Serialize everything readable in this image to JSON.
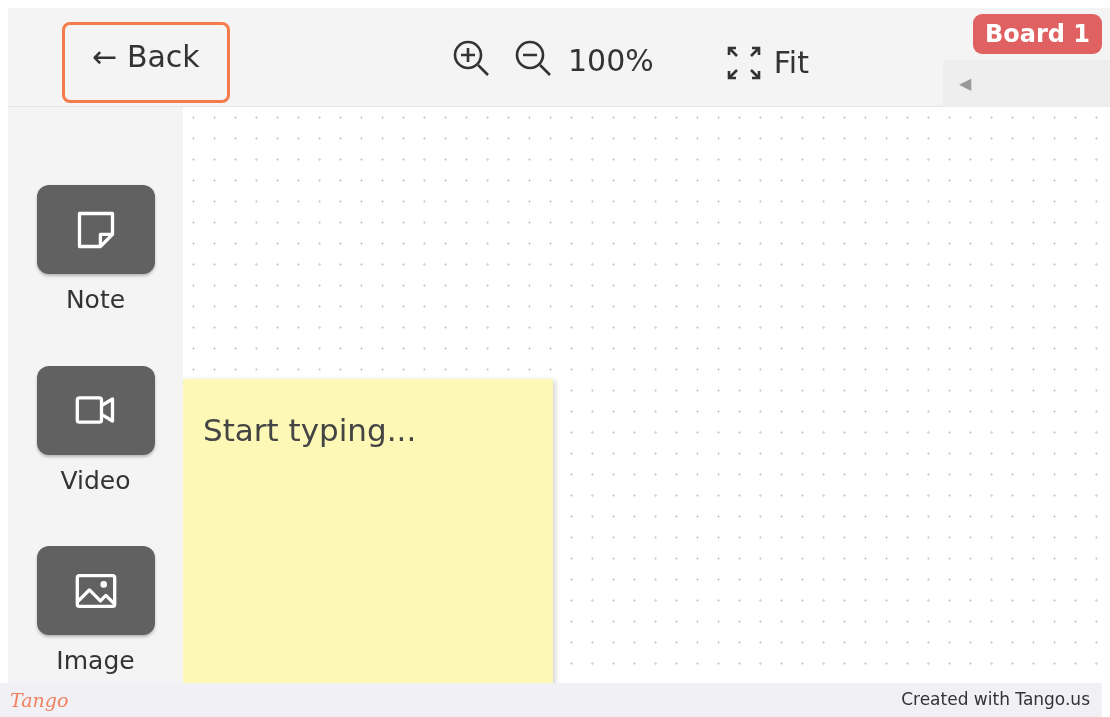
{
  "toolbar": {
    "back": "← Back",
    "zoom_level": "100%",
    "fit": "Fit",
    "board": "Board 1",
    "collapse": "◀"
  },
  "tools": [
    {
      "kind": "note",
      "label": "Note"
    },
    {
      "kind": "video",
      "label": "Video"
    },
    {
      "kind": "image",
      "label": "Image"
    }
  ],
  "sticky_note": {
    "placeholder": "Start typing..."
  },
  "footer": {
    "logo": "Tango",
    "credit": "Created with Tango.us"
  }
}
